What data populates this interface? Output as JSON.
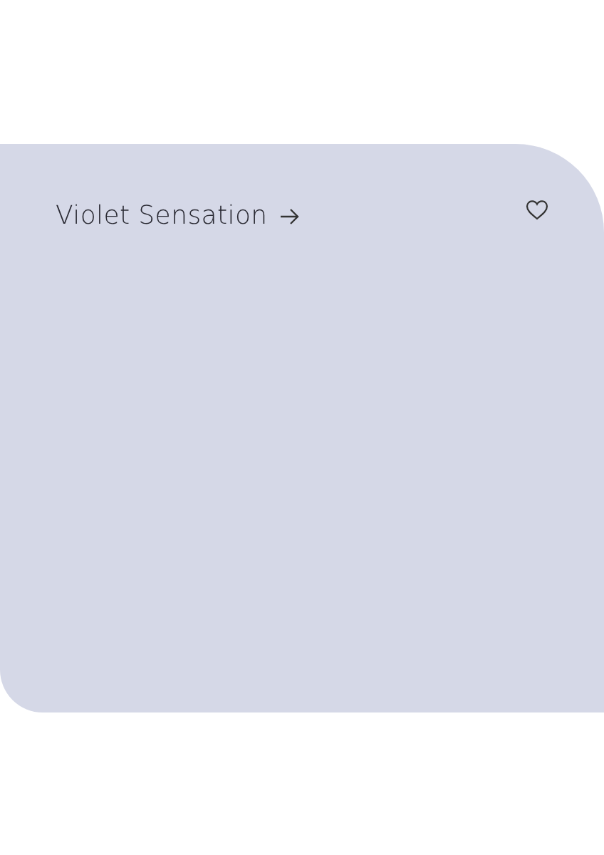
{
  "swatch": {
    "name": "Violet Sensation",
    "color": "#d5d8e7",
    "favorite": false
  }
}
